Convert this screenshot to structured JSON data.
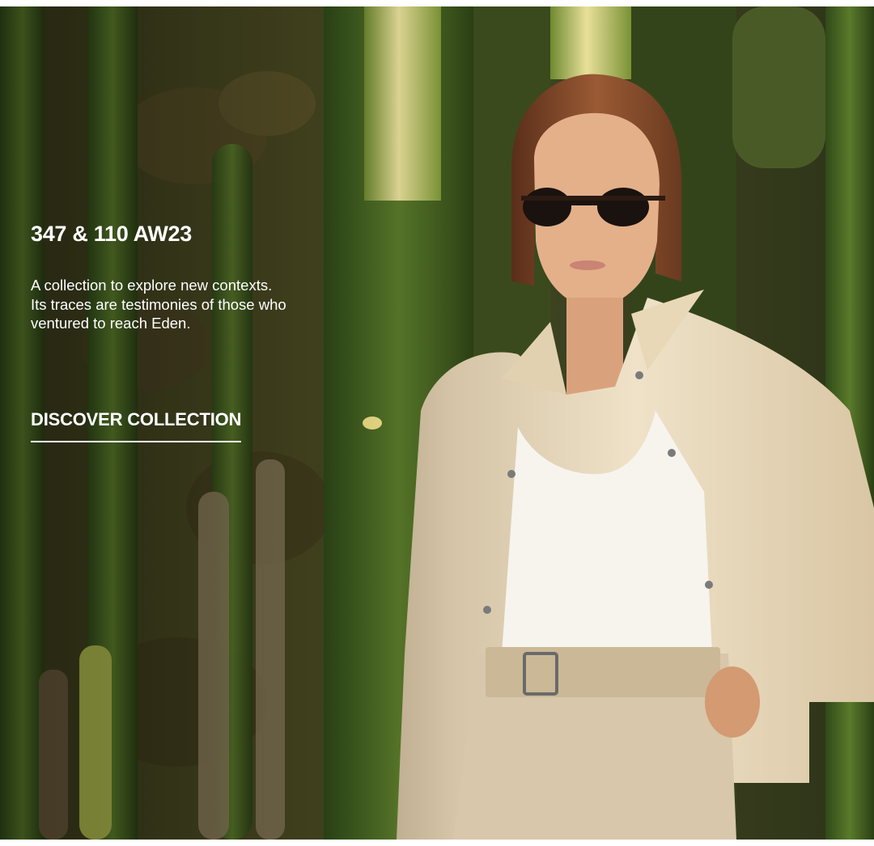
{
  "hero": {
    "title": "347 & 110 AW23",
    "description_lines": [
      "A collection to explore new contexts.",
      "Its traces are testimonies of those who",
      "ventured to reach Eden."
    ],
    "cta_label": "DISCOVER COLLECTION",
    "text_color": "#ffffff"
  },
  "icons": {
    "photo": "fashion-photo-cactus-woman-sunglasses"
  }
}
